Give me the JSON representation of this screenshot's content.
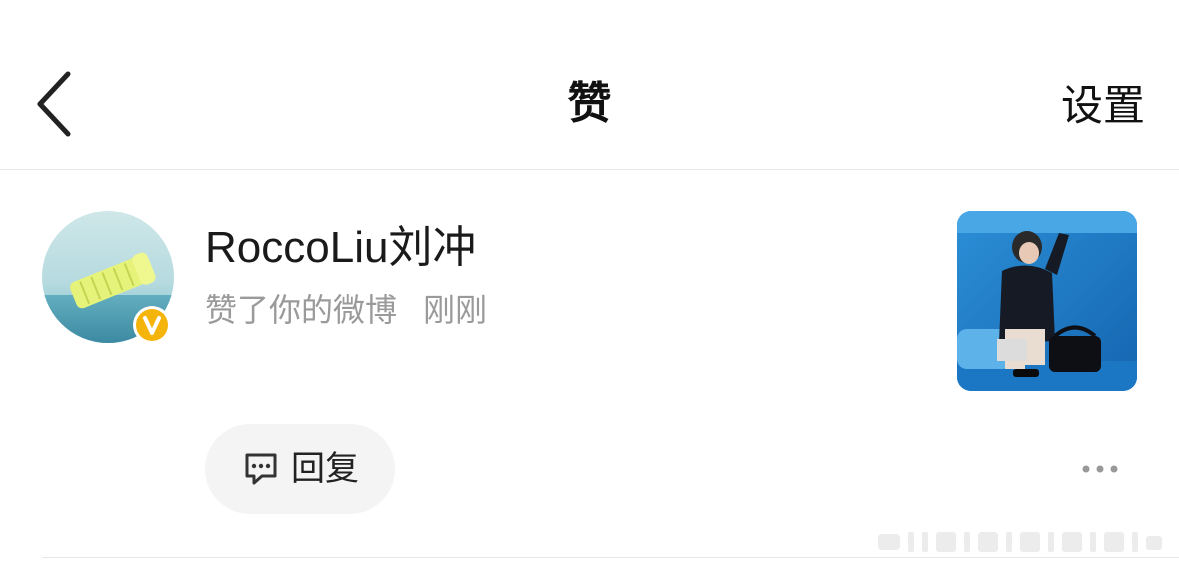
{
  "header": {
    "title": "赞",
    "settings_label": "设置",
    "back_icon": "chevron-left-icon"
  },
  "notification": {
    "username": "RoccoLiu刘冲",
    "action": "赞了你的微博",
    "time": "刚刚",
    "verified_badge_icon": "verified-v-icon",
    "badge_color": "#f5b40a",
    "reply_label": "回复",
    "reply_icon": "comment-bubble-icon",
    "more_icon": "more-dots-icon"
  }
}
